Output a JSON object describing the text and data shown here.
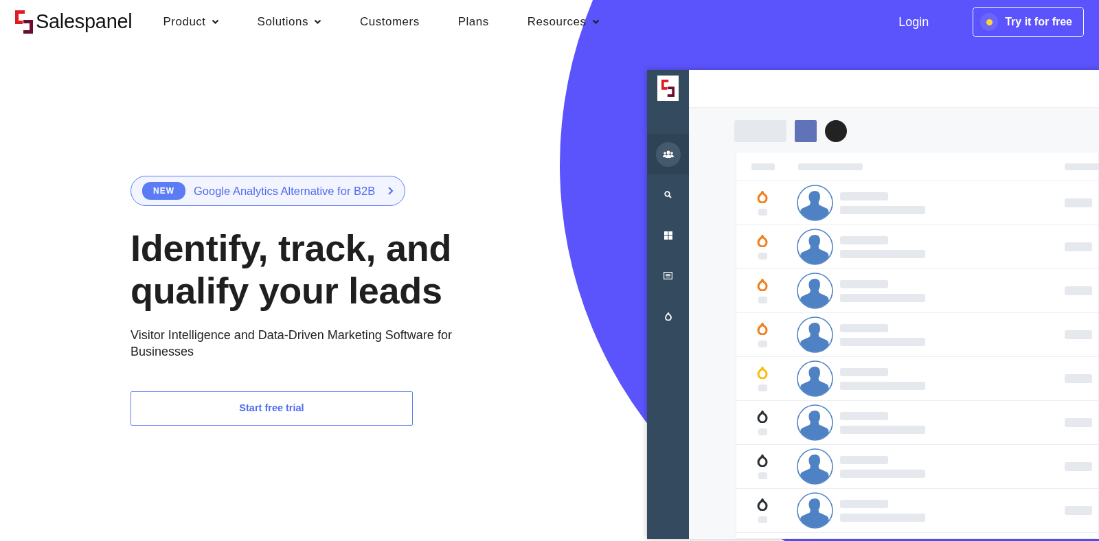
{
  "brand": {
    "name": "Salespanel"
  },
  "nav": [
    {
      "label": "Product",
      "dropdown": true
    },
    {
      "label": "Solutions",
      "dropdown": true
    },
    {
      "label": "Customers",
      "dropdown": false
    },
    {
      "label": "Plans",
      "dropdown": false
    },
    {
      "label": "Resources",
      "dropdown": true
    }
  ],
  "login": "Login",
  "try_button": "Try it for free",
  "hero": {
    "badge": "NEW",
    "announcement": "Google Analytics Alternative for B2B",
    "headline_lines": [
      "Identify, track, and",
      "qualify your leads"
    ],
    "subtitle": "Visitor Intelligence and Data-Driven Marketing Software for Businesses",
    "cta": "Start free trial"
  },
  "mockup": {
    "sidebar_items": [
      {
        "selected": true
      },
      {
        "selected": false
      },
      {
        "selected": false
      },
      {
        "selected": false
      },
      {
        "selected": false
      }
    ],
    "rows": [
      {
        "color": "#f07f1e"
      },
      {
        "color": "#f07f1e"
      },
      {
        "color": "#f07f1e"
      },
      {
        "color": "#f07f1e"
      },
      {
        "color": "#fbbc0a"
      },
      {
        "color": "#2b2f33"
      },
      {
        "color": "#2b2f33"
      },
      {
        "color": "#2b2f33"
      }
    ]
  }
}
